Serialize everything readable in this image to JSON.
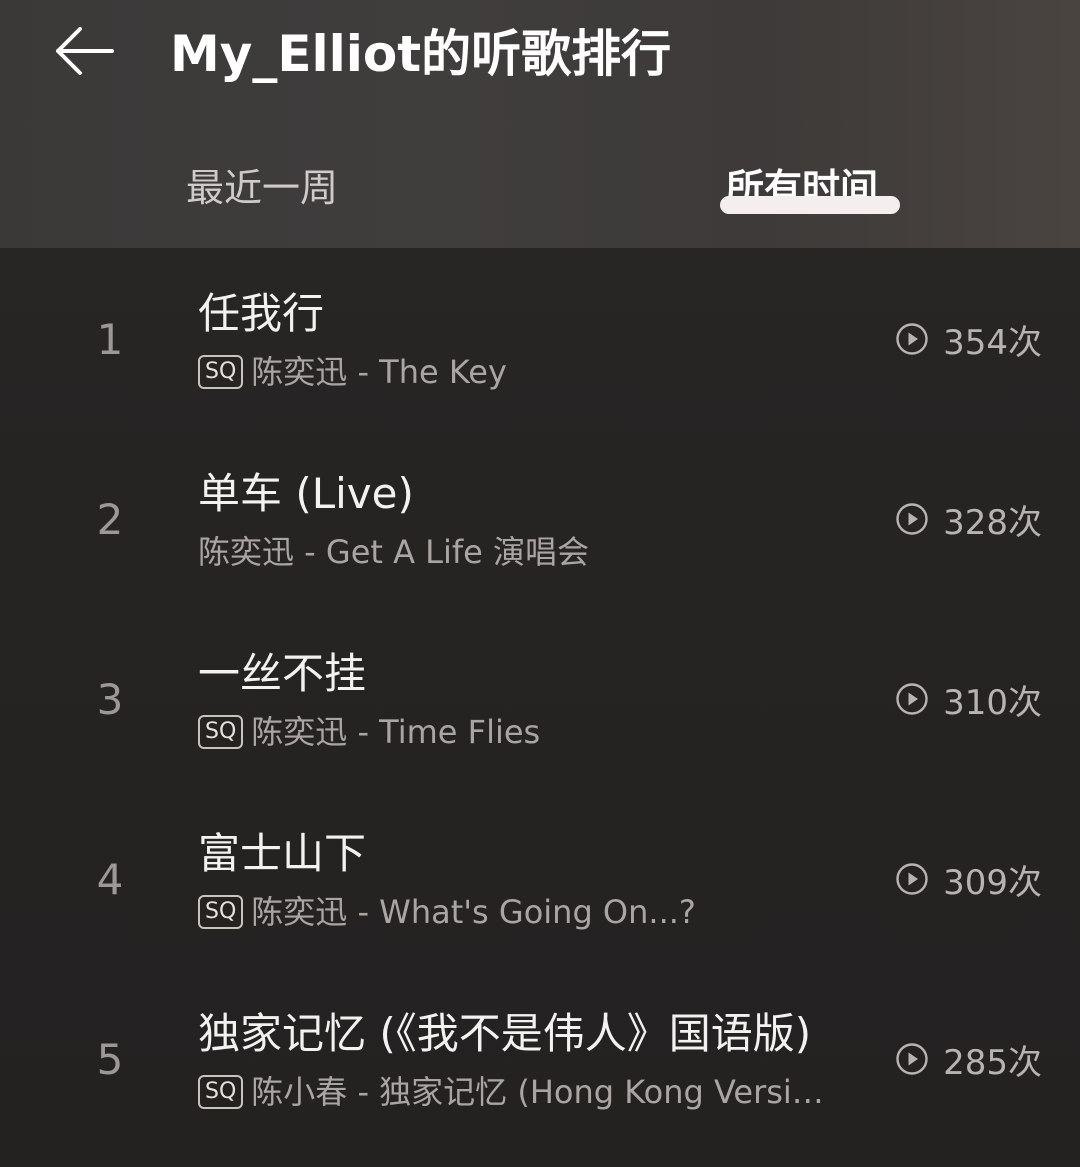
{
  "header": {
    "title": "My_Elliot的听歌排行",
    "back_icon": "back-arrow-icon"
  },
  "tabs": [
    {
      "label": "最近一周",
      "active": false
    },
    {
      "label": "所有时间",
      "active": true
    }
  ],
  "songs": [
    {
      "rank": "1",
      "title": "任我行",
      "sq": "SQ",
      "meta": "陈奕迅 - The Key",
      "plays": "354次"
    },
    {
      "rank": "2",
      "title": "单车 (Live)",
      "sq": null,
      "meta": "陈奕迅 - Get A Life 演唱会",
      "plays": "328次"
    },
    {
      "rank": "3",
      "title": "一丝不挂",
      "sq": "SQ",
      "meta": "陈奕迅 - Time Flies",
      "plays": "310次"
    },
    {
      "rank": "4",
      "title": "富士山下",
      "sq": "SQ",
      "meta": "陈奕迅 - What's Going On...?",
      "plays": "309次"
    },
    {
      "rank": "5",
      "title": "独家记忆 (《我不是伟人》国语版)",
      "sq": "SQ",
      "meta": "陈小春 - 独家记忆 (Hong Kong Versi…",
      "plays": "285次"
    }
  ],
  "icons": {
    "play": "play-circle-icon"
  },
  "colors": {
    "header_bg": "#3f3d3c",
    "list_bg": "#242221",
    "indicator": "#f4efee"
  }
}
